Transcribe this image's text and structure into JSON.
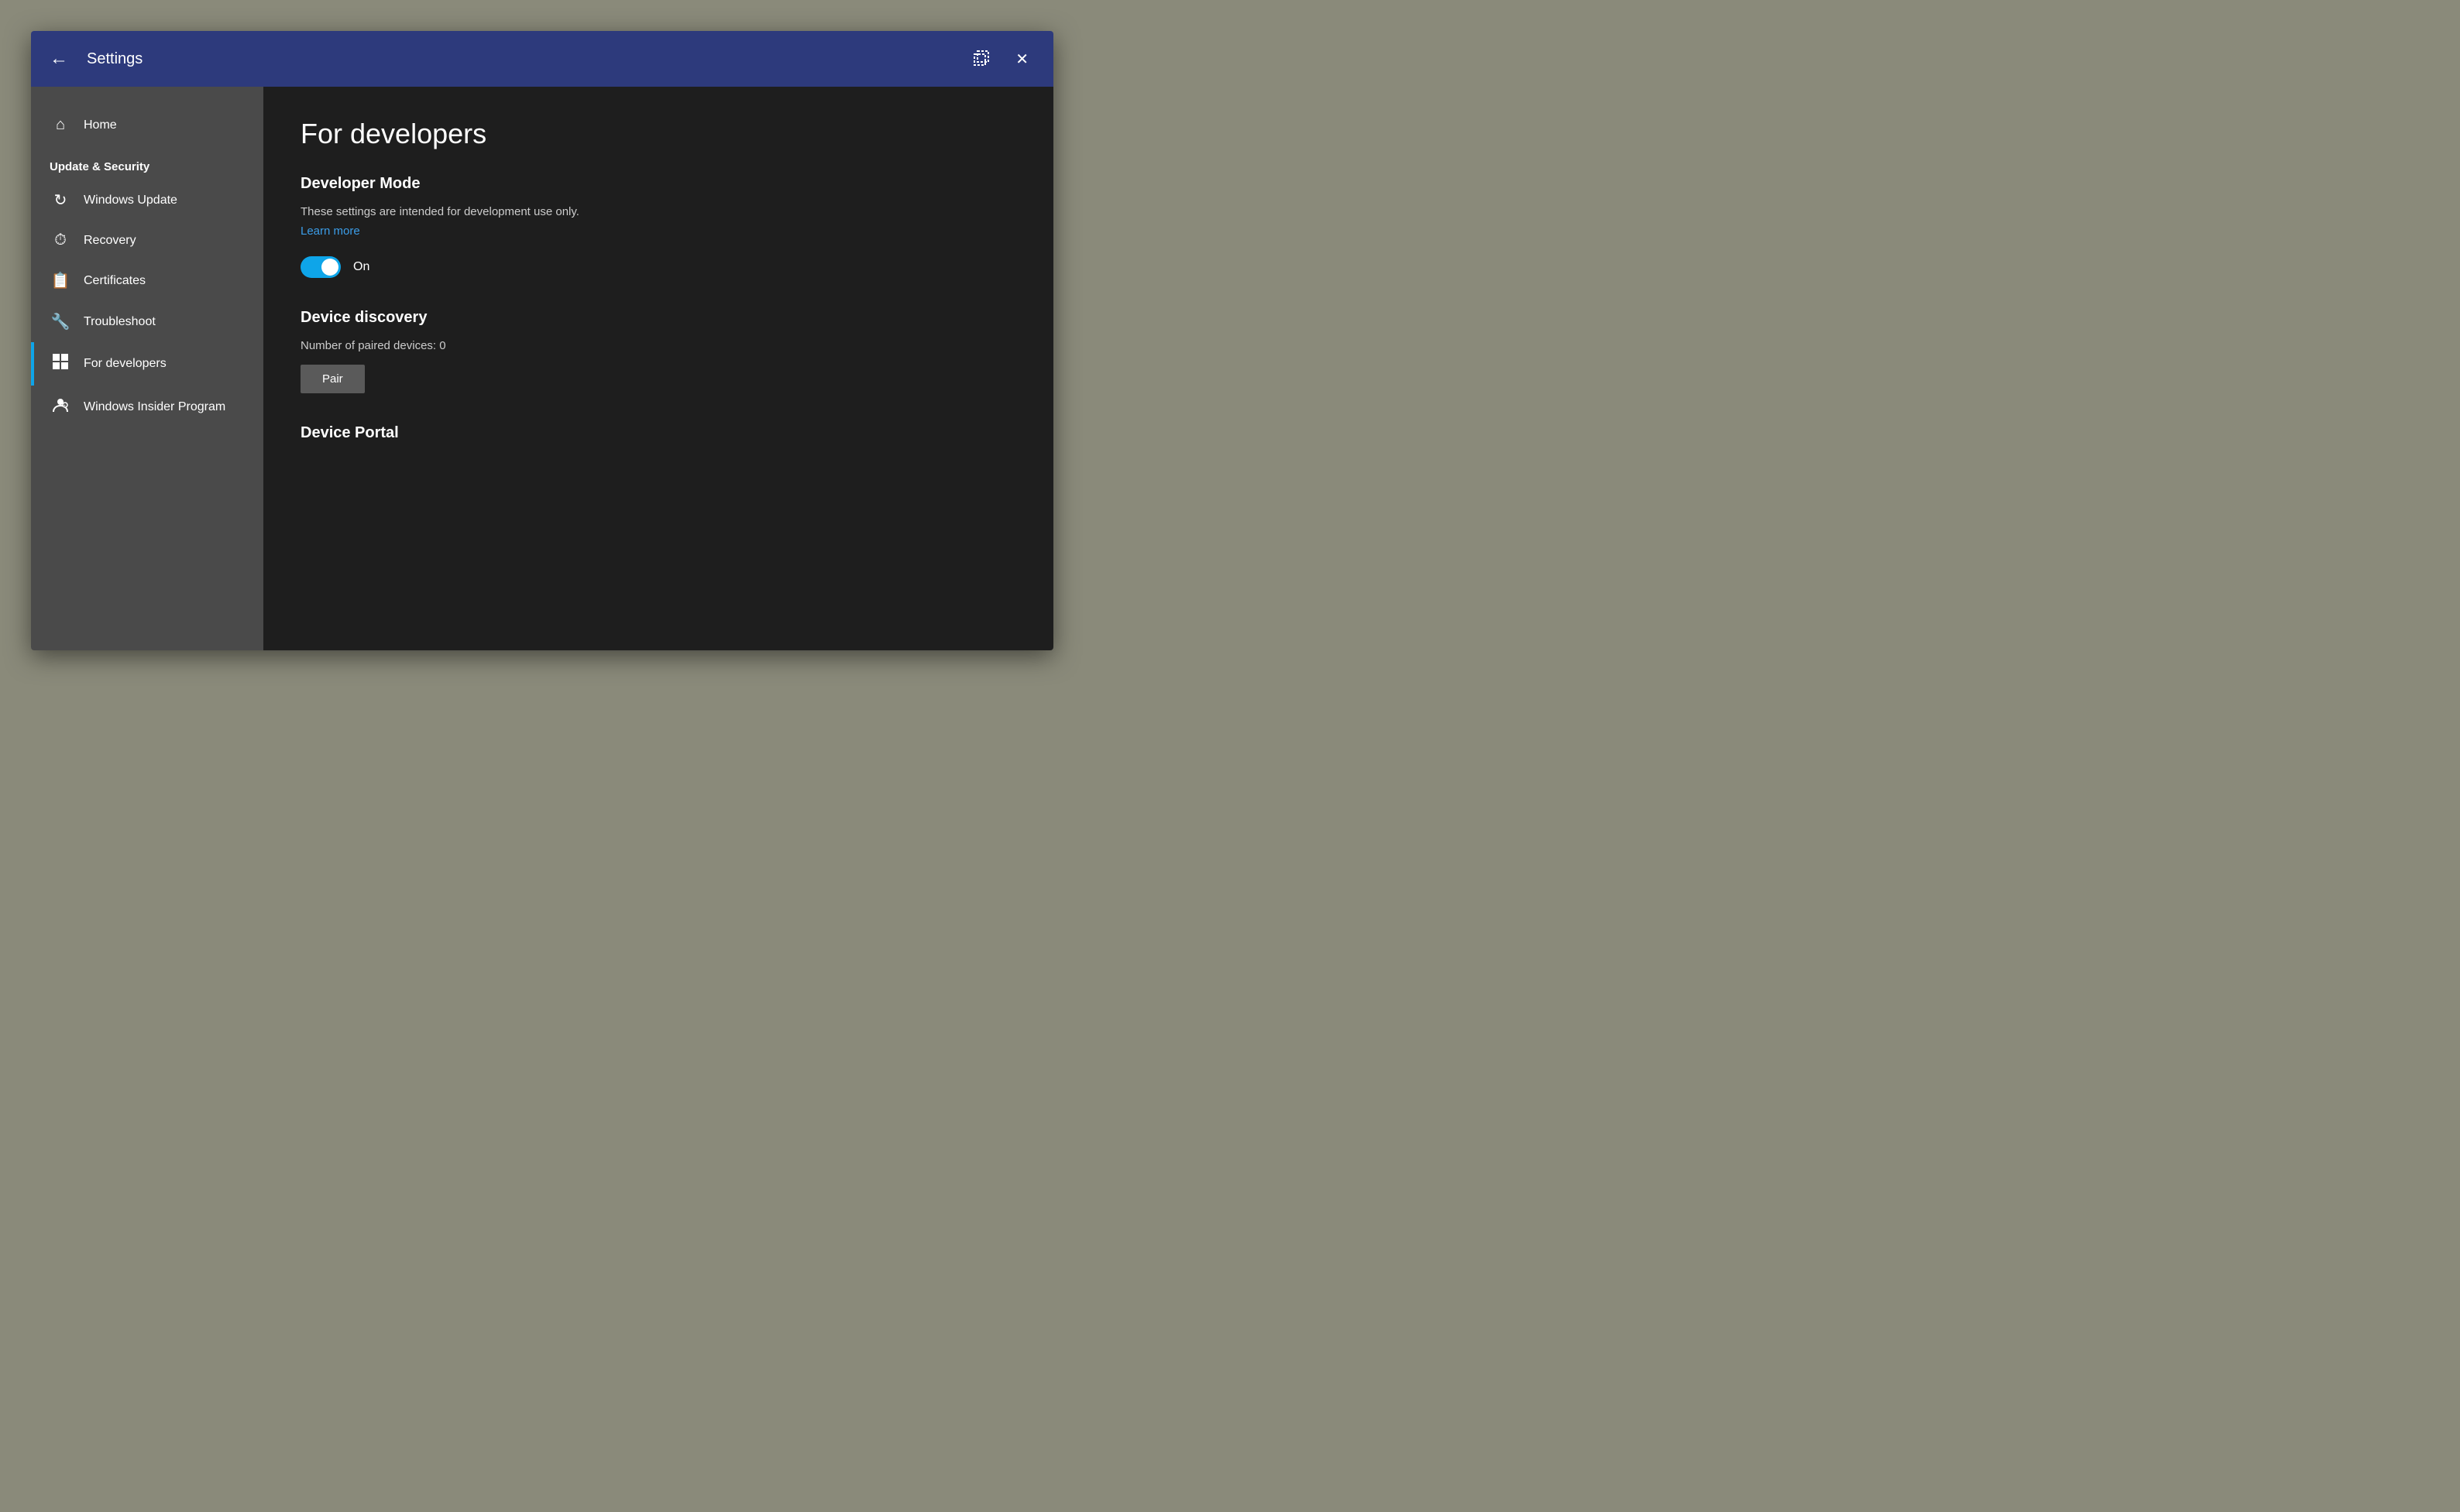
{
  "titlebar": {
    "back_label": "←",
    "title": "Settings",
    "restore_label": "⧉",
    "close_label": "✕"
  },
  "sidebar": {
    "home_label": "Home",
    "section_label": "Update & Security",
    "nav_items": [
      {
        "id": "windows-update",
        "icon": "↻",
        "label": "Windows Update",
        "active": false
      },
      {
        "id": "recovery",
        "icon": "⏱",
        "label": "Recovery",
        "active": false
      },
      {
        "id": "certificates",
        "icon": "📄",
        "label": "Certificates",
        "active": false
      },
      {
        "id": "troubleshoot",
        "icon": "🔧",
        "label": "Troubleshoot",
        "active": false
      },
      {
        "id": "for-developers",
        "icon": "⊞",
        "label": "For developers",
        "active": true
      },
      {
        "id": "windows-insider",
        "icon": "👤",
        "label": "Windows Insider Program",
        "active": false
      }
    ]
  },
  "main": {
    "page_title": "For developers",
    "developer_mode": {
      "section_title": "Developer Mode",
      "description": "These settings are intended for development use only.",
      "learn_more": "Learn more",
      "toggle_state": "On"
    },
    "device_discovery": {
      "section_title": "Device discovery",
      "paired_devices_label": "Number of paired devices: 0",
      "pair_button_label": "Pair"
    },
    "device_portal": {
      "section_title": "Device Portal"
    }
  }
}
